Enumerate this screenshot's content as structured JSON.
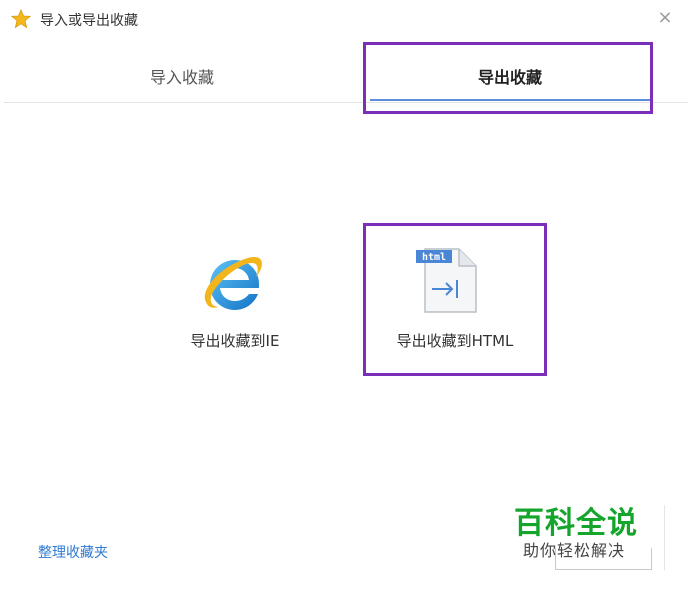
{
  "window": {
    "title": "导入或导出收藏",
    "close_glyph": "×"
  },
  "tabs": [
    {
      "label": "导入收藏",
      "active": false
    },
    {
      "label": "导出收藏",
      "active": true
    }
  ],
  "options": [
    {
      "label": "导出收藏到IE",
      "icon": "internet-explorer-icon"
    },
    {
      "label": "导出收藏到HTML",
      "icon": "html-file-export-icon",
      "icon_badge": "html"
    }
  ],
  "footer": {
    "organize_link": "整理收藏夹"
  },
  "watermark": {
    "title": "百科全说",
    "subtitle": "助你轻松解决"
  },
  "colors": {
    "accent": "#5b8ed9",
    "highlight": "#7b2fb8",
    "link": "#2f7ad1",
    "watermark_green": "#15a52c"
  }
}
